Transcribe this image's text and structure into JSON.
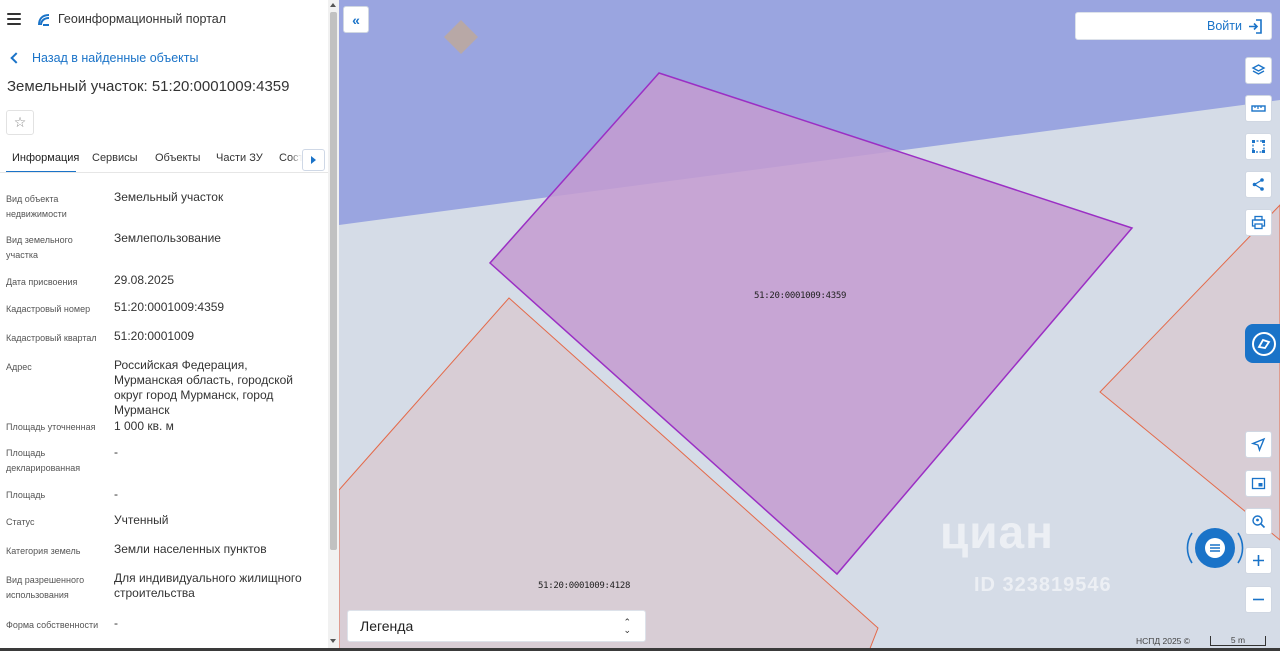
{
  "header": {
    "title": "Геоинформационный портал"
  },
  "panel": {
    "back_label": "Назад в найденные объекты",
    "object_title": "Земельный участок: 51:20:0001009:4359",
    "tabs": [
      {
        "label": "Информация"
      },
      {
        "label": "Сервисы"
      },
      {
        "label": "Объекты"
      },
      {
        "label": "Части ЗУ"
      },
      {
        "label": "Соста"
      }
    ],
    "properties": [
      {
        "label": "Вид объекта недвижимости",
        "value": "Земельный участок"
      },
      {
        "label": "Вид земельного участка",
        "value": "Землепользование"
      },
      {
        "label": "Дата присвоения",
        "value": "29.08.2025"
      },
      {
        "label": "Кадастровый номер",
        "value": "51:20:0001009:4359"
      },
      {
        "label": "Кадастровый квартал",
        "value": "51:20:0001009"
      },
      {
        "label": "Адрес",
        "value": "Российская Федерация, Мурманская область, городской округ город Мурманск, город Мурманск"
      },
      {
        "label": "Площадь уточненная",
        "value": "1 000 кв. м"
      },
      {
        "label": "Площадь декларированная",
        "value": "-"
      },
      {
        "label": "Площадь",
        "value": "-"
      },
      {
        "label": "Статус",
        "value": "Учтенный"
      },
      {
        "label": "Категория земель",
        "value": "Земли населенных пунктов"
      },
      {
        "label": "Вид разрешенного использования",
        "value": "Для индивидуального жилищного строительства"
      },
      {
        "label": "Форма собственности",
        "value": "-"
      }
    ]
  },
  "map": {
    "login_label": "Войти",
    "legend_label": "Легенда",
    "parcel_main": "51:20:0001009:4359",
    "parcel_other": "51:20:0001009:4128",
    "watermark": "циан",
    "watermark_id": "ID 323819546",
    "copyright": "НСПД 2025 ©",
    "scale": "5 m",
    "colors": {
      "selected_fill": "#c49bd0",
      "selected_stroke": "#9b2fc4",
      "water": "#9aa5e0",
      "parcel_fill": "#d8cdd5",
      "parcel_stroke": "#e46a4a",
      "accent": "#1a73c8"
    }
  },
  "icons": {
    "tools": [
      "layers-icon",
      "ruler-icon",
      "select-area-icon",
      "share-icon",
      "print-icon",
      "locate-icon",
      "minimap-icon",
      "geo-search-icon",
      "zoom-in-icon",
      "zoom-out-icon"
    ]
  }
}
